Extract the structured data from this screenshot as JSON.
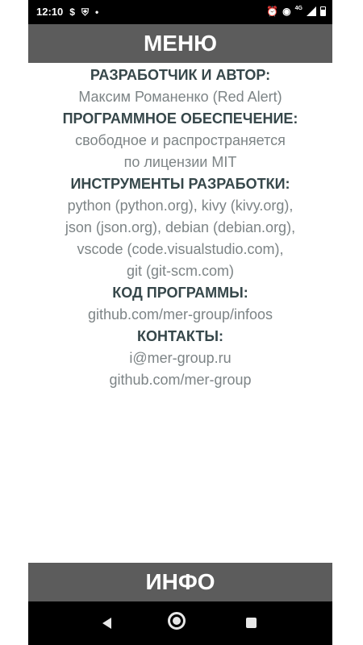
{
  "status_bar": {
    "time": "12:10",
    "icons_left": [
      "dollar-icon",
      "shield-icon",
      "dot-icon"
    ],
    "icons_right": [
      "alarm-icon",
      "wifi-icon",
      "signal-icon",
      "battery-icon"
    ],
    "network": "4G"
  },
  "header": {
    "title": "МЕНЮ"
  },
  "about": {
    "developer_heading": "РАЗРАБОТЧИК И АВТОР:",
    "developer_name": "Максим Романенко (Red Alert)",
    "software_heading": "ПРОГРАММНОЕ ОБЕСПЕЧЕНИЕ:",
    "software_line1": "свободное и распространяется",
    "software_line2": "по лицензии MIT",
    "tools_heading": "ИНСТРУМЕНТЫ РАЗРАБОТКИ:",
    "tools": [
      "python (python.org), kivy (kivy.org),",
      "json (json.org), debian (debian.org),",
      "vscode (code.visualstudio.com),",
      "git (git-scm.com)"
    ],
    "code_heading": "КОД ПРОГРАММЫ:",
    "code_link": "github.com/mer-group/infoos",
    "contacts_heading": "КОНТАКТЫ:",
    "contacts": [
      "i@mer-group.ru",
      "github.com/mer-group"
    ]
  },
  "footer": {
    "title": "ИНФО"
  },
  "nav_bar": {
    "buttons": [
      "back",
      "home",
      "recents"
    ]
  },
  "colors": {
    "header_bg": "#5c5c5c",
    "heading_text": "#36474a",
    "body_text": "#7d8486"
  }
}
